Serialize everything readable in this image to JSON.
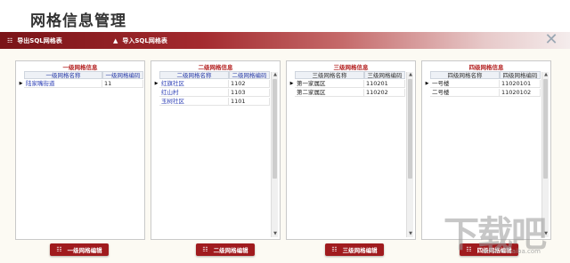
{
  "page": {
    "title": "网格信息管理"
  },
  "toolbar": {
    "export_label": "导出SQL网格表",
    "import_label": "导入SQL网格表",
    "export_icon": "grid-icon",
    "import_icon": "arrow-up-icon",
    "close_icon": "close-icon"
  },
  "panels": [
    {
      "title": "一级网格信息",
      "headers": [
        "一级网格名称",
        "一级网格编码"
      ],
      "rows": [
        {
          "name": "陆家嘴街道",
          "code": "11",
          "selected": true
        }
      ],
      "button": "一级网格编辑"
    },
    {
      "title": "二级网格信息",
      "headers": [
        "二级网格名称",
        "二级网格编码"
      ],
      "rows": [
        {
          "name": "红旗社区",
          "code": "1102",
          "selected": true
        },
        {
          "name": "红山村",
          "code": "1103",
          "selected": false
        },
        {
          "name": "玉树社区",
          "code": "1101",
          "selected": false
        }
      ],
      "button": "二级网格编辑"
    },
    {
      "title": "三级网格信息",
      "headers": [
        "三级网格名称",
        "三级网格编码"
      ],
      "rows": [
        {
          "name": "第一家属区",
          "code": "110201",
          "selected": true
        },
        {
          "name": "第二家属区",
          "code": "110202",
          "selected": false
        }
      ],
      "button": "三级网格编辑"
    },
    {
      "title": "四级网格信息",
      "headers": [
        "四级网格名称",
        "四级网格编码"
      ],
      "rows": [
        {
          "name": "一号楼",
          "code": "11020101",
          "selected": true
        },
        {
          "name": "二号楼",
          "code": "11020102",
          "selected": false
        }
      ],
      "button": "四级网格编辑"
    }
  ],
  "watermark": {
    "text": "下载吧",
    "url": "www.xiazaiba.com"
  },
  "colors": {
    "brand": "#a01b1e",
    "link": "#2d3fb5",
    "panel_title": "#b52424"
  }
}
